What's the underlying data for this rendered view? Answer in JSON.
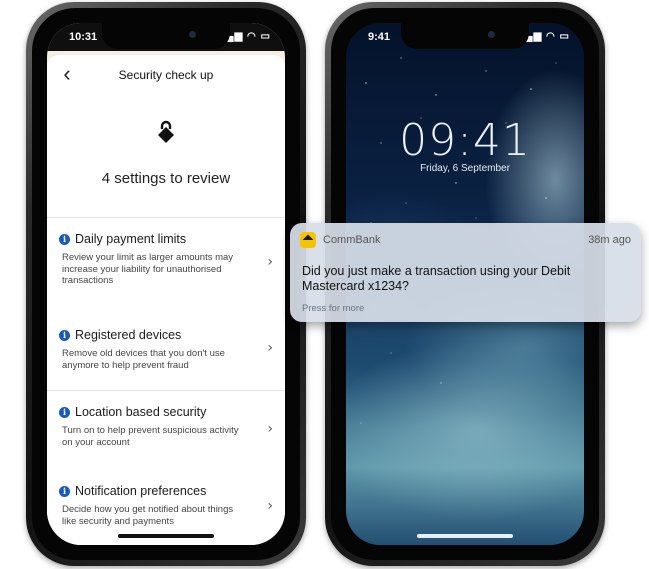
{
  "left_phone": {
    "status_time": "10:31",
    "status_icons": "▂▄▆ ◠ ▭",
    "nav": {
      "back_glyph": "‹",
      "title": "Security check up"
    },
    "icon_name": "lock-icon",
    "summary": "4 settings to review",
    "items": [
      {
        "title": "Daily payment limits",
        "desc": "Review your limit as larger amounts may increase your liability for unauthorised transactions"
      },
      {
        "title": "Registered devices",
        "desc": "Remove old devices that you don't use anymore to help prevent fraud"
      },
      {
        "title": "Location based security",
        "desc": "Turn on to help prevent suspicious activity on your account"
      },
      {
        "title": "Notification preferences",
        "desc": "Decide how you get notified about things like security and payments"
      }
    ],
    "chevron": "›",
    "info_glyph": "i"
  },
  "right_phone": {
    "status_time": "9:41",
    "status_icons": "▂▄▆ ◠ ▭",
    "clock": "09:41",
    "date": "Friday, 6 September"
  },
  "notification": {
    "app_name": "CommBank",
    "time": "38m ago",
    "body": "Did you just make a transaction using your Debit Mastercard x1234?",
    "footer": "Press for more"
  },
  "colors": {
    "info_blue": "#1a58b9",
    "commbank_yellow": "#f5c400"
  }
}
